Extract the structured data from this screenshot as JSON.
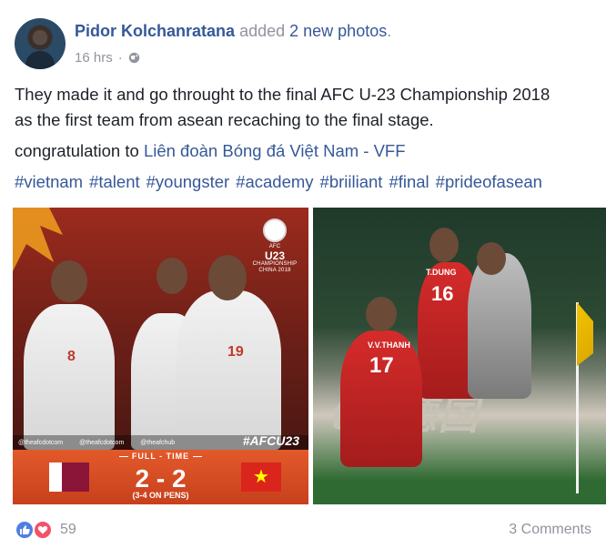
{
  "post": {
    "author": "Pidor Kolchanratana",
    "action_prefix": "added",
    "action_link": "2 new photos",
    "action_suffix": ".",
    "timestamp": "16 hrs",
    "separator": "·",
    "privacy_icon": "globe-icon",
    "text_line1": "They made it and go throught to the final AFC U-23 Championship 2018",
    "text_line2": "as the first team from asean recaching to the final stage.",
    "congrats_prefix": "congratulation to",
    "congrats_page": "Liên đoàn Bóng đá Việt Nam - VFF",
    "hashtags": [
      "#vietnam",
      "#talent",
      "#youngster",
      "#academy",
      "#briiliant",
      "#final",
      "#prideofasean"
    ]
  },
  "photo1": {
    "logo_afc": "AFC",
    "logo_u23": "U23",
    "logo_championship": "CHAMPIONSHIP",
    "logo_country": "CHINA 2018",
    "number_left": "8",
    "number_right": "19",
    "social_handles": [
      "@theafcdotcom",
      "@theafcdotcom",
      "@theafchub"
    ],
    "hashtag": "#AFCU23",
    "result_label": "FULL - TIME",
    "score": "2 - 2",
    "pens": "(3-4 ON PENS)",
    "vietnam_star": "★"
  },
  "photo2": {
    "number_front": "17",
    "name_front": "V.V.THANH",
    "number_back": "16",
    "name_back": "T.DUNG",
    "board_text": "tai 德国"
  },
  "footer": {
    "reactions_count": "59",
    "comments": "3 Comments",
    "like_icon": "thumbs-up-icon",
    "love_icon": "heart-icon"
  },
  "colors": {
    "link": "#365899",
    "muted": "#90949c",
    "like": "#4e7fe3",
    "love": "#f25268"
  }
}
